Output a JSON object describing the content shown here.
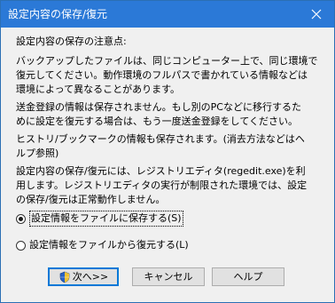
{
  "window": {
    "title": "設定内容の保存/復元",
    "close_glyph": "✕"
  },
  "content": {
    "heading": "設定内容の保存の注意点:",
    "para1": "バックアップしたファイルは、同じコンピューター上で、同じ環境で\n復元してください。動作環境のフルパスで書かれている情報などは\n環境によって異なることがあります。",
    "para2": "送金登録の情報は保存されません。もし別のPCなどに移行するた\nめに設定を復元する場合は、もう一度送金登録をしてください。",
    "para3": "ヒストリ/ブックマークの情報も保存されます。(消去方法などはヘ\nルプ参照)",
    "para4": "設定内容の保存/復元には、レジストリエディタ(regedit.exe)を利\n用します。レジストリエディタの実行が制限された環境では、設定\nの保存/復元は正常動作しません。"
  },
  "options": {
    "save_label": "設定情報をファイルに保存する(S)",
    "save_selected": true,
    "restore_label": "設定情報をファイルから復元する(L)",
    "restore_selected": false
  },
  "buttons": {
    "next_label": "次へ>>",
    "cancel_label": "キャンセル",
    "help_label": "ヘルプ"
  },
  "colors": {
    "titlebar": "#2b79d7",
    "default_button_border": "#0078d7"
  }
}
